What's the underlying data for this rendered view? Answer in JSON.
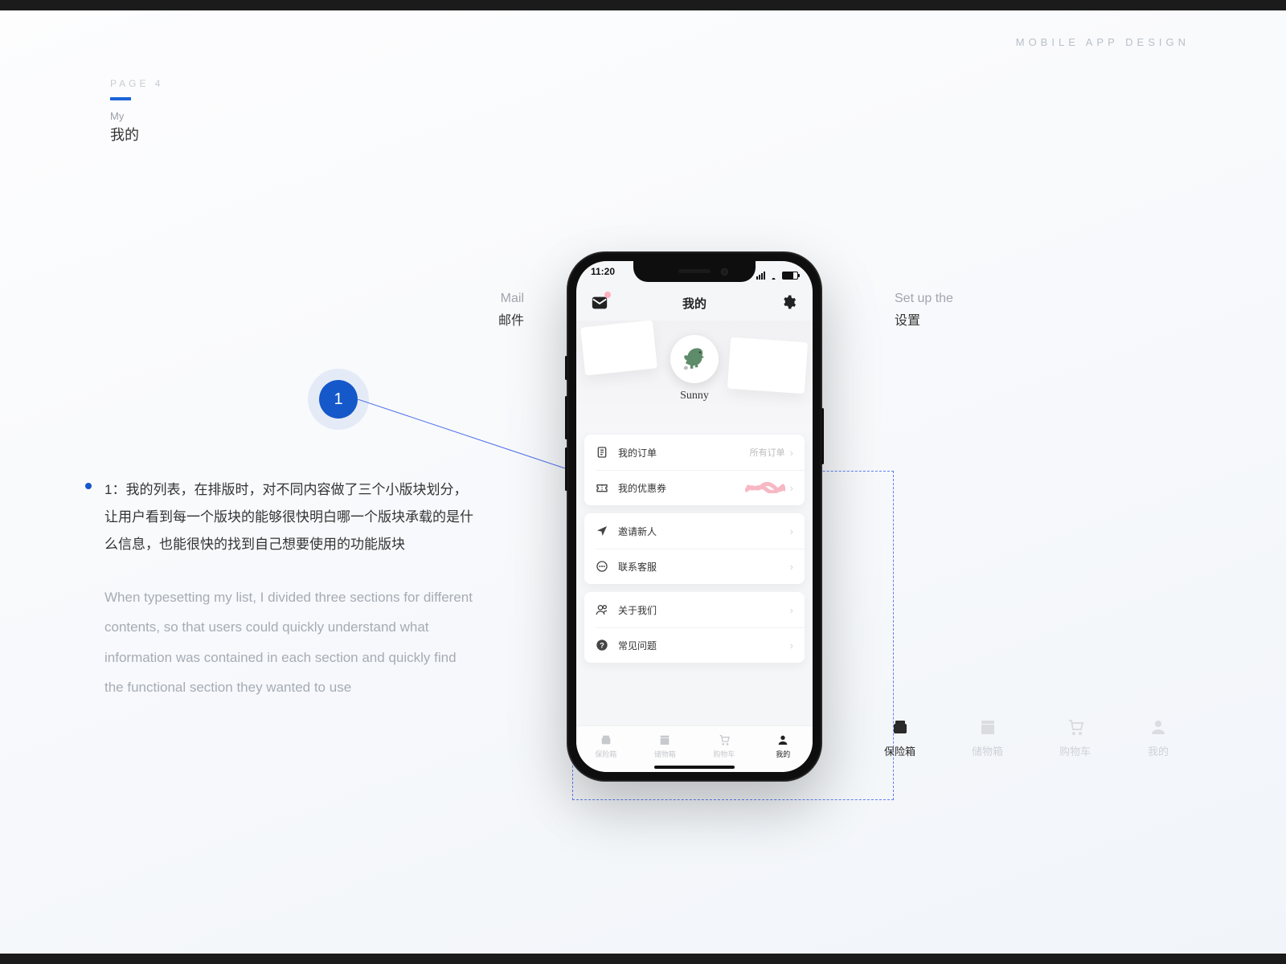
{
  "header": {
    "label": "MOBILE APP DESIGN"
  },
  "page_meta": {
    "number": "PAGE 4",
    "en": "My",
    "cn": "我的"
  },
  "callouts": {
    "mail": {
      "en": "Mail",
      "cn": "邮件"
    },
    "settings": {
      "en": "Set up the",
      "cn": "设置"
    }
  },
  "annotation": {
    "badge": "1",
    "cn": "1：我的列表，在排版时，对不同内容做了三个小版块划分，让用户看到每一个版块的能够很快明白哪一个版块承载的是什么信息，也能很快的找到自己想要使用的功能版块",
    "en": "When typesetting my list, I divided three sections for different contents, so that users could quickly understand what information was contained in each section and quickly find the functional section they wanted to use"
  },
  "phone": {
    "time": "11:20",
    "title": "我的",
    "username": "Sunny",
    "groups": [
      {
        "rows": [
          {
            "icon": "order-icon",
            "label": "我的订单",
            "aux": "所有订单"
          },
          {
            "icon": "coupon-icon",
            "label": "我的优惠券",
            "scribble": true
          }
        ]
      },
      {
        "rows": [
          {
            "icon": "invite-icon",
            "label": "邀请新人"
          },
          {
            "icon": "support-icon",
            "label": "联系客服"
          }
        ]
      },
      {
        "rows": [
          {
            "icon": "about-icon",
            "label": "关于我们"
          },
          {
            "icon": "faq-icon",
            "label": "常见问题"
          }
        ]
      }
    ],
    "tabs": [
      {
        "icon": "safe-icon",
        "label": "保险箱",
        "active": false
      },
      {
        "icon": "locker-icon",
        "label": "储物箱",
        "active": false
      },
      {
        "icon": "cart-icon",
        "label": "购物车",
        "active": false
      },
      {
        "icon": "profile-icon",
        "label": "我的",
        "active": true
      }
    ]
  },
  "ext_tabs": [
    {
      "icon": "safe-icon",
      "label": "保险箱",
      "active": true
    },
    {
      "icon": "locker-icon",
      "label": "储物箱",
      "active": false
    },
    {
      "icon": "cart-icon",
      "label": "购物车",
      "active": false
    },
    {
      "icon": "profile-icon",
      "label": "我的",
      "active": false
    }
  ]
}
